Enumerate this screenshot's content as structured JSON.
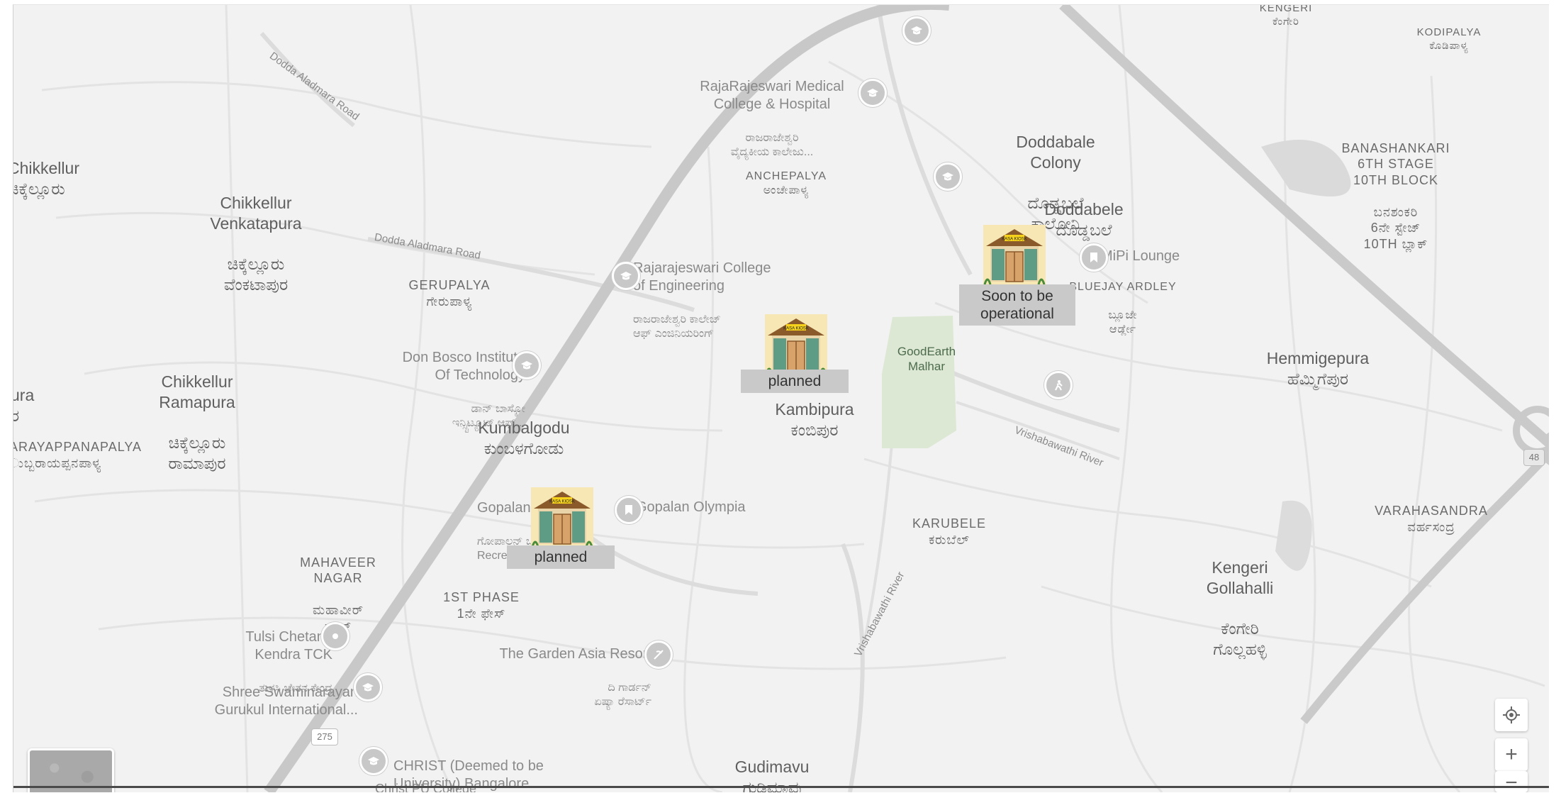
{
  "map": {
    "places": [
      {
        "id": "chikkellur",
        "en": "Chikkellur",
        "kn": "ಚಿಕ್ಕೆಲ್ಲೂರು"
      },
      {
        "id": "chikkellur-venkatapura",
        "en": "Chikkellur\nVenkatapura",
        "kn": "ಚಿಕ್ಕೆಲ್ಲೂರು\nವೆಂಕಟಾಪುರ"
      },
      {
        "id": "chikkellur-ramapura",
        "en": "Chikkellur\nRamapura",
        "kn": "ಚಿಕ್ಕೆಲ್ಲೂರು\nರಾಮಾಪುರ"
      },
      {
        "id": "kumbalgodu",
        "en": "Kumbalgodu",
        "kn": "ಕುಂಬಳಗೋಡು"
      },
      {
        "id": "kambipura",
        "en": "Kambipura",
        "kn": "ಕಂಬಿಪುರ"
      },
      {
        "id": "doddabale-colony",
        "en": "Doddabale\nColony",
        "kn": "ದೊಡ್ಡಬಲೆ\nಕಾಲೋನಿ"
      },
      {
        "id": "doddabele",
        "en": "Doddabele",
        "kn": "ದೊಡ್ಡಬಲೆ"
      },
      {
        "id": "hemmigepura",
        "en": "Hemmigepura",
        "kn": "ಹೆಮ್ಮಿಗೆಪುರ"
      },
      {
        "id": "kengeri-gollahalli",
        "en": "Kengeri\nGollahalli",
        "kn": "ಕೆಂಗೇರಿ\nಗೊಲ್ಲಹಳ್ಳಿ"
      },
      {
        "id": "gudimavu",
        "en": "Gudimavu",
        "kn": "ಗುಡಿಮಾವು"
      },
      {
        "id": "ura",
        "en": "ura",
        "kn": "ರ"
      }
    ],
    "small_places": [
      {
        "id": "gerupalya",
        "en": "GERUPALYA",
        "kn": "ಗೇರುಪಾಳ್ಯ"
      },
      {
        "id": "anchepalya",
        "en": "ANCHEPALYA",
        "kn": "ಅಂಚೇಪಾಳ್ಯ"
      },
      {
        "id": "karubele",
        "en": "KARUBELE",
        "kn": "ಕರುಬೆಲ್"
      },
      {
        "id": "mahaveer-nagar",
        "en": "MAHAVEER\nNAGAR",
        "kn": "ಮಹಾವೀರ್\nನಗರ್"
      },
      {
        "id": "first-phase",
        "en": "1ST PHASE",
        "kn": "1ನೇ ಫೇಸ್"
      },
      {
        "id": "bluejay-ardley",
        "en": "BLUEJAY ARDLEY",
        "kn": "ಬ್ಲೂಜೇ\nಆರ್ಡ್ಲೇ"
      },
      {
        "id": "banashankari",
        "en": "BANASHANKARI\n6TH STAGE\n10TH BLOCK",
        "kn": "ಬನಶಂಕರಿ\n6ನೇ ಸ್ಟೇಜ್\n10TH ಬ್ಲಾಕ್"
      },
      {
        "id": "varahasandra",
        "en": "VARAHASANDRA",
        "kn": "ವರ್ಹಸಂದ್ರ"
      },
      {
        "id": "kengeri-top",
        "en": "KENGERI",
        "kn": "ಕೆಂಗೇರಿ"
      },
      {
        "id": "kodipalya",
        "en": "KODIPALYA",
        "kn": "ಕೊಡಿಪಾಳ್ಯ"
      },
      {
        "id": "arayappanapalya",
        "en": "ARAYAPPANAPALYA",
        "kn": "ುಬ್ಬರಾಯಪ್ಪನಪಾಳ್ಯ"
      }
    ],
    "pois": [
      {
        "id": "rajarajeswari-medical",
        "en": "RajaRajeswari Medical\nCollege & Hospital",
        "kn": "ರಾಜರಾಜೇಶ್ವರಿ\nವೈದ್ಯಕೀಯ ಕಾಲೇಜು..."
      },
      {
        "id": "rajarajeswari-engineering",
        "en": "Rajarajeswari College\nof Engineering",
        "kn": "ರಾಜರಾಜೇಶ್ವರಿ ಕಾಲೇಜ್\nಆಫ್ ಎಂಜಿನಿಯರಿಂಗ್"
      },
      {
        "id": "don-bosco",
        "en": "Don Bosco Institute\nOf Technology",
        "kn": "ಡಾನ್ ಬಾಸ್ಕೋ\nಇನ್ಸ್ಟಿಟ್ಯೂಟ್ ಆಫ್..."
      },
      {
        "id": "gopalan-olympia-left",
        "en": "Gopalan Olympia",
        "kn": "ಗೋಪಾಲನ್ ಒಲಿಂಪಿಯಾ\nRecre..."
      },
      {
        "id": "gopalan-olympia",
        "en": "Gopalan Olympia",
        "kn": ""
      },
      {
        "id": "mipi-lounge",
        "en": "MiPi Lounge",
        "kn": ""
      },
      {
        "id": "tulsi-chetana",
        "en": "Tulsi Chetana\nKendra TCK",
        "kn": "ತುಳಸಿ ಚೇತನ ಕೇಂದ್ರ"
      },
      {
        "id": "shree-swaminarayan",
        "en": "Shree Swaminarayan\nGurukul International...",
        "kn": ""
      },
      {
        "id": "garden-asia",
        "en": "The Garden Asia Resort",
        "kn": "ದಿ ಗಾರ್ಡನ್\nಏಷ್ಯಾ ರೆಸಾರ್ಟ್"
      },
      {
        "id": "christ",
        "en": "CHRIST (Deemed to be\nUniversity) Bangalore...",
        "kn": ""
      },
      {
        "id": "christ-pu",
        "en": "Christ PU College",
        "kn": ""
      }
    ],
    "park": {
      "name": "GoodEarth\nMalhar"
    },
    "roads": [
      {
        "id": "dodda-aladmara-1",
        "name": "Dodda Aladmara Road"
      },
      {
        "id": "dodda-aladmara-2",
        "name": "Dodda Aladmara Road"
      },
      {
        "id": "vrishabawathi-river",
        "name": "Vrishabawathi River"
      },
      {
        "id": "vrishabawathi-river-2",
        "name": "Vrishabawathi River"
      }
    ],
    "shields": [
      {
        "id": "shield-275",
        "text": "275"
      },
      {
        "id": "shield-48",
        "text": "48"
      }
    ],
    "kiosks": [
      {
        "id": "kiosk-kumbalgodu",
        "status": "planned",
        "sign": "KASA KIOSK"
      },
      {
        "id": "kiosk-kambipura",
        "status": "planned",
        "sign": "KASA KIOSK"
      },
      {
        "id": "kiosk-doddabele",
        "status": "Soon to be\noperational",
        "sign": "KASA KIOSK"
      }
    ],
    "controls": {
      "locate_icon": "crosshair-icon",
      "zoom_in": "+",
      "zoom_out": "−",
      "layer_toggle": "satellite-thumbnail"
    },
    "colors": {
      "background": "#f2f2f2",
      "road": "#d6d6d6",
      "highway": "#c4c4c4",
      "park": "#dce8d4",
      "badge": "#c9c9c9"
    }
  }
}
